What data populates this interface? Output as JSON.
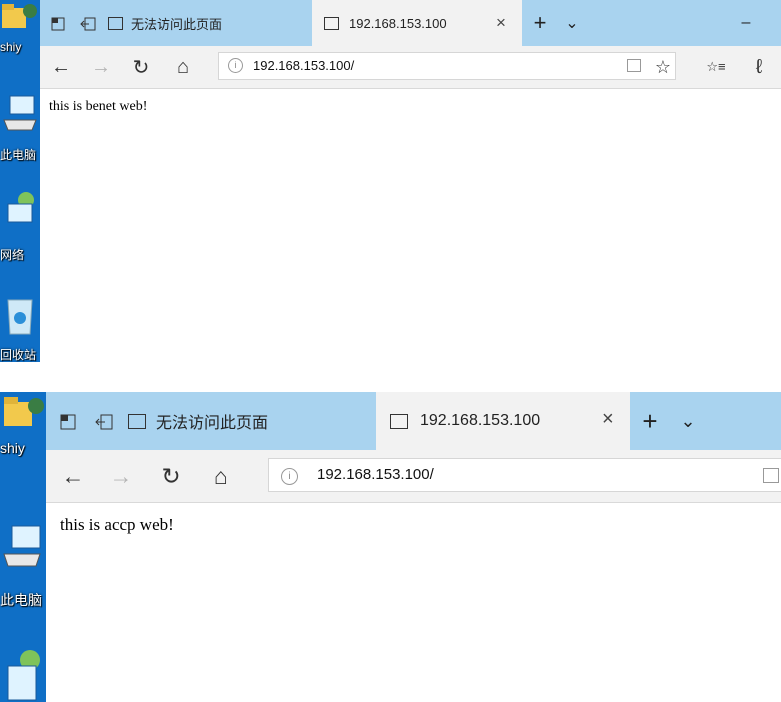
{
  "colors": {
    "desktop": "#0f6fc6",
    "tabbar": "#a9d3ef",
    "toolbar": "#f2f2f2",
    "page": "#ffffff"
  },
  "desktop_icons": {
    "user_label": "shiy",
    "computer_label": "此电脑",
    "network_label": "网络",
    "recycle_label": "回收站"
  },
  "screenshot_top": {
    "tab_inactive": {
      "icon": "page-icon",
      "label": "无法访问此页面"
    },
    "tab_active": {
      "icon": "page-icon",
      "label": "192.168.153.100",
      "close": "×"
    },
    "new_tab": "+",
    "tab_list": "⌄",
    "minimize": "–",
    "address": "192.168.153.100/",
    "body_text": "this is benet web!"
  },
  "screenshot_bottom": {
    "tab_inactive": {
      "icon": "page-icon",
      "label": "无法访问此页面"
    },
    "tab_active": {
      "icon": "page-icon",
      "label": "192.168.153.100",
      "close": "×"
    },
    "new_tab": "+",
    "tab_list": "⌄",
    "address": "192.168.153.100/",
    "body_text": "this is accp web!"
  },
  "nav_glyphs": {
    "back": "←",
    "forward": "→",
    "refresh": "↻",
    "home": "⌂",
    "favorite": "☆",
    "favorites_list": "☆≡",
    "notes": "ℓ"
  }
}
